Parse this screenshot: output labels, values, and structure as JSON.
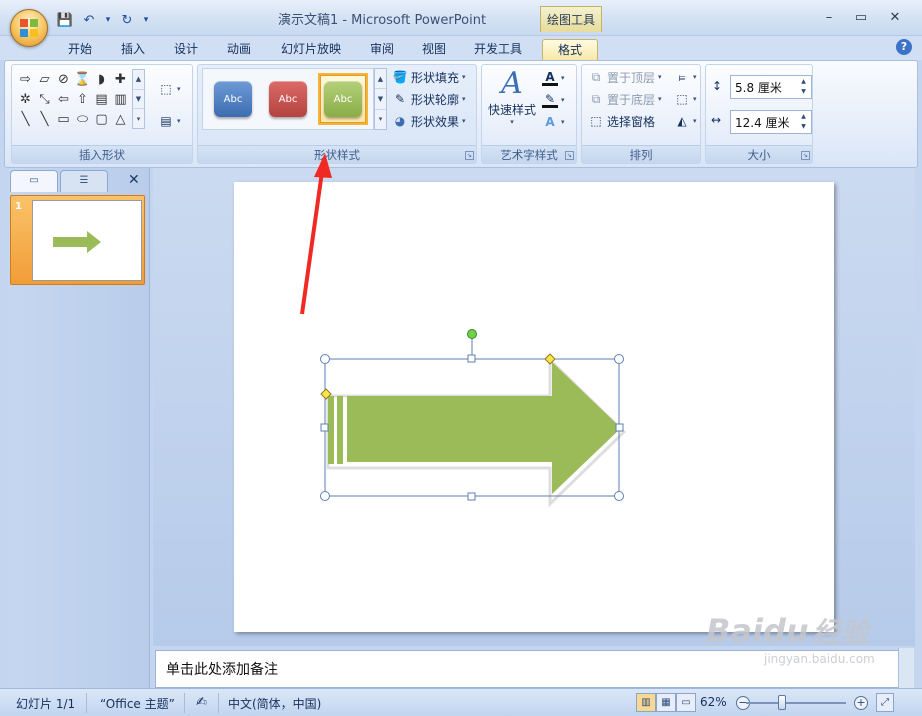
{
  "window": {
    "title": "演示文稿1 - Microsoft PowerPoint",
    "context_tools": "绘图工具",
    "controls": {
      "minimize": "–",
      "maximize": "▭",
      "close": "✕"
    }
  },
  "qat": {
    "save_icon": "💾",
    "undo_icon": "↶",
    "dropdown": "▾",
    "redo_icon": "↻",
    "customize": "▾"
  },
  "tabs": [
    {
      "label": "开始"
    },
    {
      "label": "插入"
    },
    {
      "label": "设计"
    },
    {
      "label": "动画"
    },
    {
      "label": "幻灯片放映"
    },
    {
      "label": "审阅"
    },
    {
      "label": "视图"
    },
    {
      "label": "开发工具"
    },
    {
      "label": "格式",
      "active": true
    }
  ],
  "help": "?",
  "ribbon": {
    "insert_shapes": {
      "label": "插入形状",
      "shapes": [
        "⇨",
        "▱",
        "⊘",
        "⌛",
        "◗",
        "✚",
        "✲",
        "⤡",
        "⇦",
        "⇧",
        "▤",
        "▥",
        "╲",
        "╲",
        "▭",
        "⬭",
        "▢",
        "△"
      ],
      "edit_shape_icon": "⬚",
      "textbox_icon": "▤"
    },
    "shape_styles": {
      "label": "形状样式",
      "presets": [
        {
          "text": "Abc",
          "color": "#4f81bd"
        },
        {
          "text": "Abc",
          "color": "#c0504d"
        },
        {
          "text": "Abc",
          "color": "#9bbb59",
          "selected": true
        }
      ],
      "fill": "形状填充",
      "outline": "形状轮廓",
      "effects": "形状效果"
    },
    "wordart": {
      "label": "艺术字样式",
      "quick_styles": "快速样式"
    },
    "arrange": {
      "label": "排列",
      "bring_front": "置于顶层",
      "send_back": "置于底层",
      "selection_pane": "选择窗格"
    },
    "size": {
      "label": "大小",
      "height": "5.8 厘米",
      "width": "12.4 厘米"
    }
  },
  "slides_pane": {
    "slide_number": "1"
  },
  "notes_placeholder": "单击此处添加备注",
  "status": {
    "slide": "幻灯片 1/1",
    "theme": "“Office 主题”",
    "language": "中文(简体，中国)",
    "zoom": "62%"
  },
  "watermark": {
    "brand": "Baidu",
    "cn": "经验",
    "url": "jingyan.baidu.com"
  },
  "colors": {
    "arrow_fill": "#9bbb59",
    "annotation_arrow": "#f02a22",
    "selection_border": "#5d80b3"
  }
}
